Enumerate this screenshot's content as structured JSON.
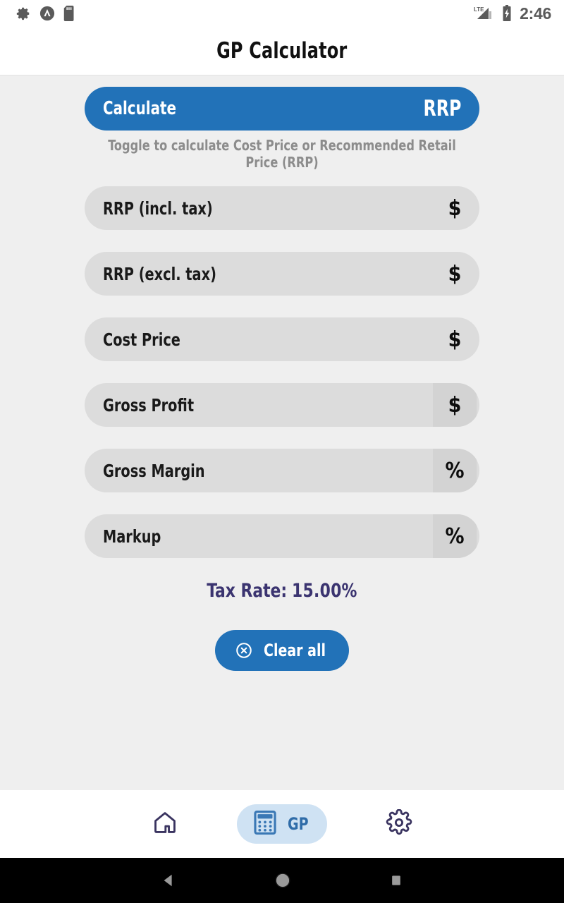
{
  "status_bar": {
    "time": "2:46",
    "left_icons": [
      "gear-icon",
      "app-logo-icon",
      "sd-card-icon"
    ],
    "right_icons": [
      "lte-signal-icon",
      "battery-charging-icon"
    ],
    "network_label": "LTE"
  },
  "header": {
    "title": "GP Calculator"
  },
  "toggle": {
    "label": "Calculate",
    "value": "RRP",
    "hint": "Toggle to calculate Cost Price or Recommended Retail Price (RRP)",
    "color": "#2272b8"
  },
  "fields": [
    {
      "label": "RRP (incl. tax)",
      "value": "",
      "suffix": "$",
      "suffix_boxed": false
    },
    {
      "label": "RRP (excl. tax)",
      "value": "",
      "suffix": "$",
      "suffix_boxed": false
    },
    {
      "label": "Cost Price",
      "value": "",
      "suffix": "$",
      "suffix_boxed": false
    },
    {
      "label": "Gross Profit",
      "value": "",
      "suffix": "$",
      "suffix_boxed": true
    },
    {
      "label": "Gross Margin",
      "value": "",
      "suffix": "%",
      "suffix_boxed": true
    },
    {
      "label": "Markup",
      "value": "",
      "suffix": "%",
      "suffix_boxed": true
    }
  ],
  "tax_rate": {
    "label": "Tax Rate:",
    "value": "15.00%",
    "color": "#3b3470"
  },
  "clear_button": {
    "label": "Clear all",
    "icon": "circle-x-icon",
    "color": "#2272b8"
  },
  "bottom_nav": {
    "items": [
      {
        "icon": "home-icon",
        "label": "",
        "selected": false
      },
      {
        "icon": "calculator-icon",
        "label": "GP",
        "selected": true
      },
      {
        "icon": "gear-icon",
        "label": "",
        "selected": false
      }
    ],
    "selected_bg": "#cfe2f3",
    "accent": "#2f6ca8"
  },
  "system_nav": {
    "buttons": [
      "back-icon",
      "home-icon",
      "recents-icon"
    ]
  }
}
